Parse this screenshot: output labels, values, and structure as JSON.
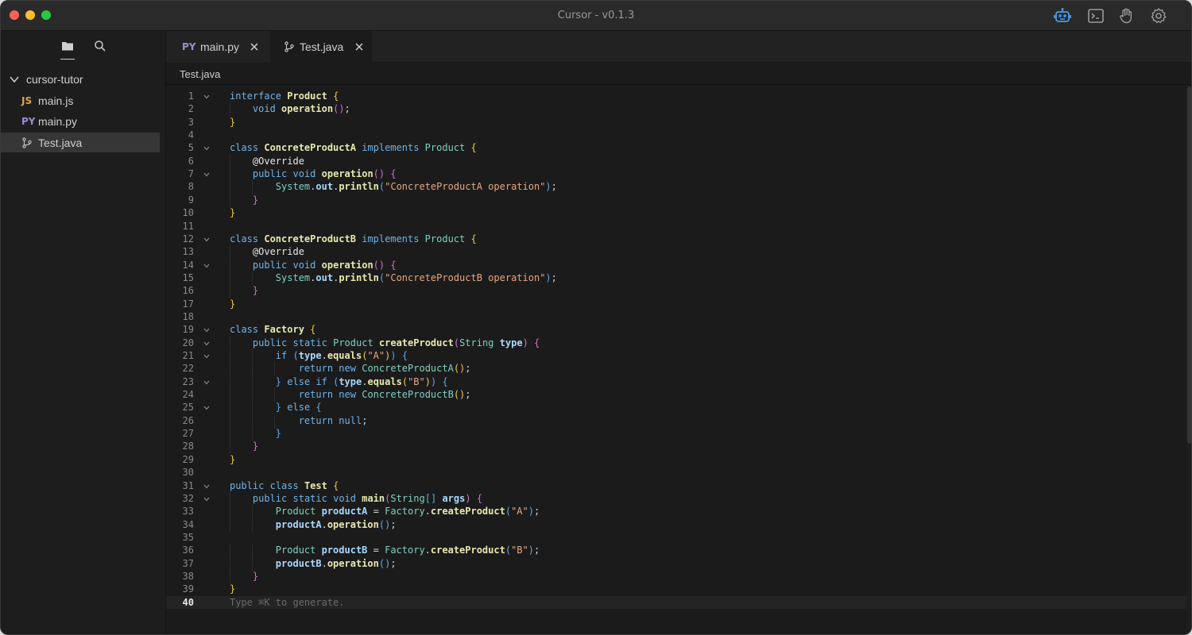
{
  "window": {
    "title": "Cursor - v0.1.3"
  },
  "titlebar_icons": [
    "robot-icon",
    "terminal-icon",
    "hand-icon",
    "gear-icon"
  ],
  "colors": {
    "accent": "#4a9fe8",
    "background": "#1b1b1b",
    "sidebar": "#1d1d1d"
  },
  "sidebar": {
    "tools": [
      "folder-icon",
      "search-icon"
    ],
    "root": "cursor-tutor",
    "files": [
      {
        "badge": "JS",
        "name": "main.js"
      },
      {
        "badge": "PY",
        "name": "main.py"
      },
      {
        "badge": "",
        "name": "Test.java",
        "active": true
      }
    ]
  },
  "tabs": [
    {
      "badge": "PY",
      "label": "main.py"
    },
    {
      "badge": "",
      "label": "Test.java",
      "active": true
    }
  ],
  "breadcrumb": "Test.java",
  "editor": {
    "current_line": 40,
    "placeholder": "Type ⌘K to generate.",
    "lines": [
      "interface Product {",
      "    void operation();",
      "}",
      "",
      "class ConcreteProductA implements Product {",
      "    @Override",
      "    public void operation() {",
      "        System.out.println(\"ConcreteProductA operation\");",
      "    }",
      "}",
      "",
      "class ConcreteProductB implements Product {",
      "    @Override",
      "    public void operation() {",
      "        System.out.println(\"ConcreteProductB operation\");",
      "    }",
      "}",
      "",
      "class Factory {",
      "    public static Product createProduct(String type) {",
      "        if (type.equals(\"A\")) {",
      "            return new ConcreteProductA();",
      "        } else if (type.equals(\"B\")) {",
      "            return new ConcreteProductB();",
      "        } else {",
      "            return null;",
      "        }",
      "    }",
      "}",
      "",
      "public class Test {",
      "    public static void main(String[] args) {",
      "        Product productA = Factory.createProduct(\"A\");",
      "        productA.operation();",
      "",
      "        Product productB = Factory.createProduct(\"B\");",
      "        productB.operation();",
      "    }",
      "}",
      ""
    ],
    "fold_lines": [
      1,
      5,
      7,
      12,
      14,
      19,
      20,
      21,
      23,
      25,
      31,
      32
    ]
  }
}
